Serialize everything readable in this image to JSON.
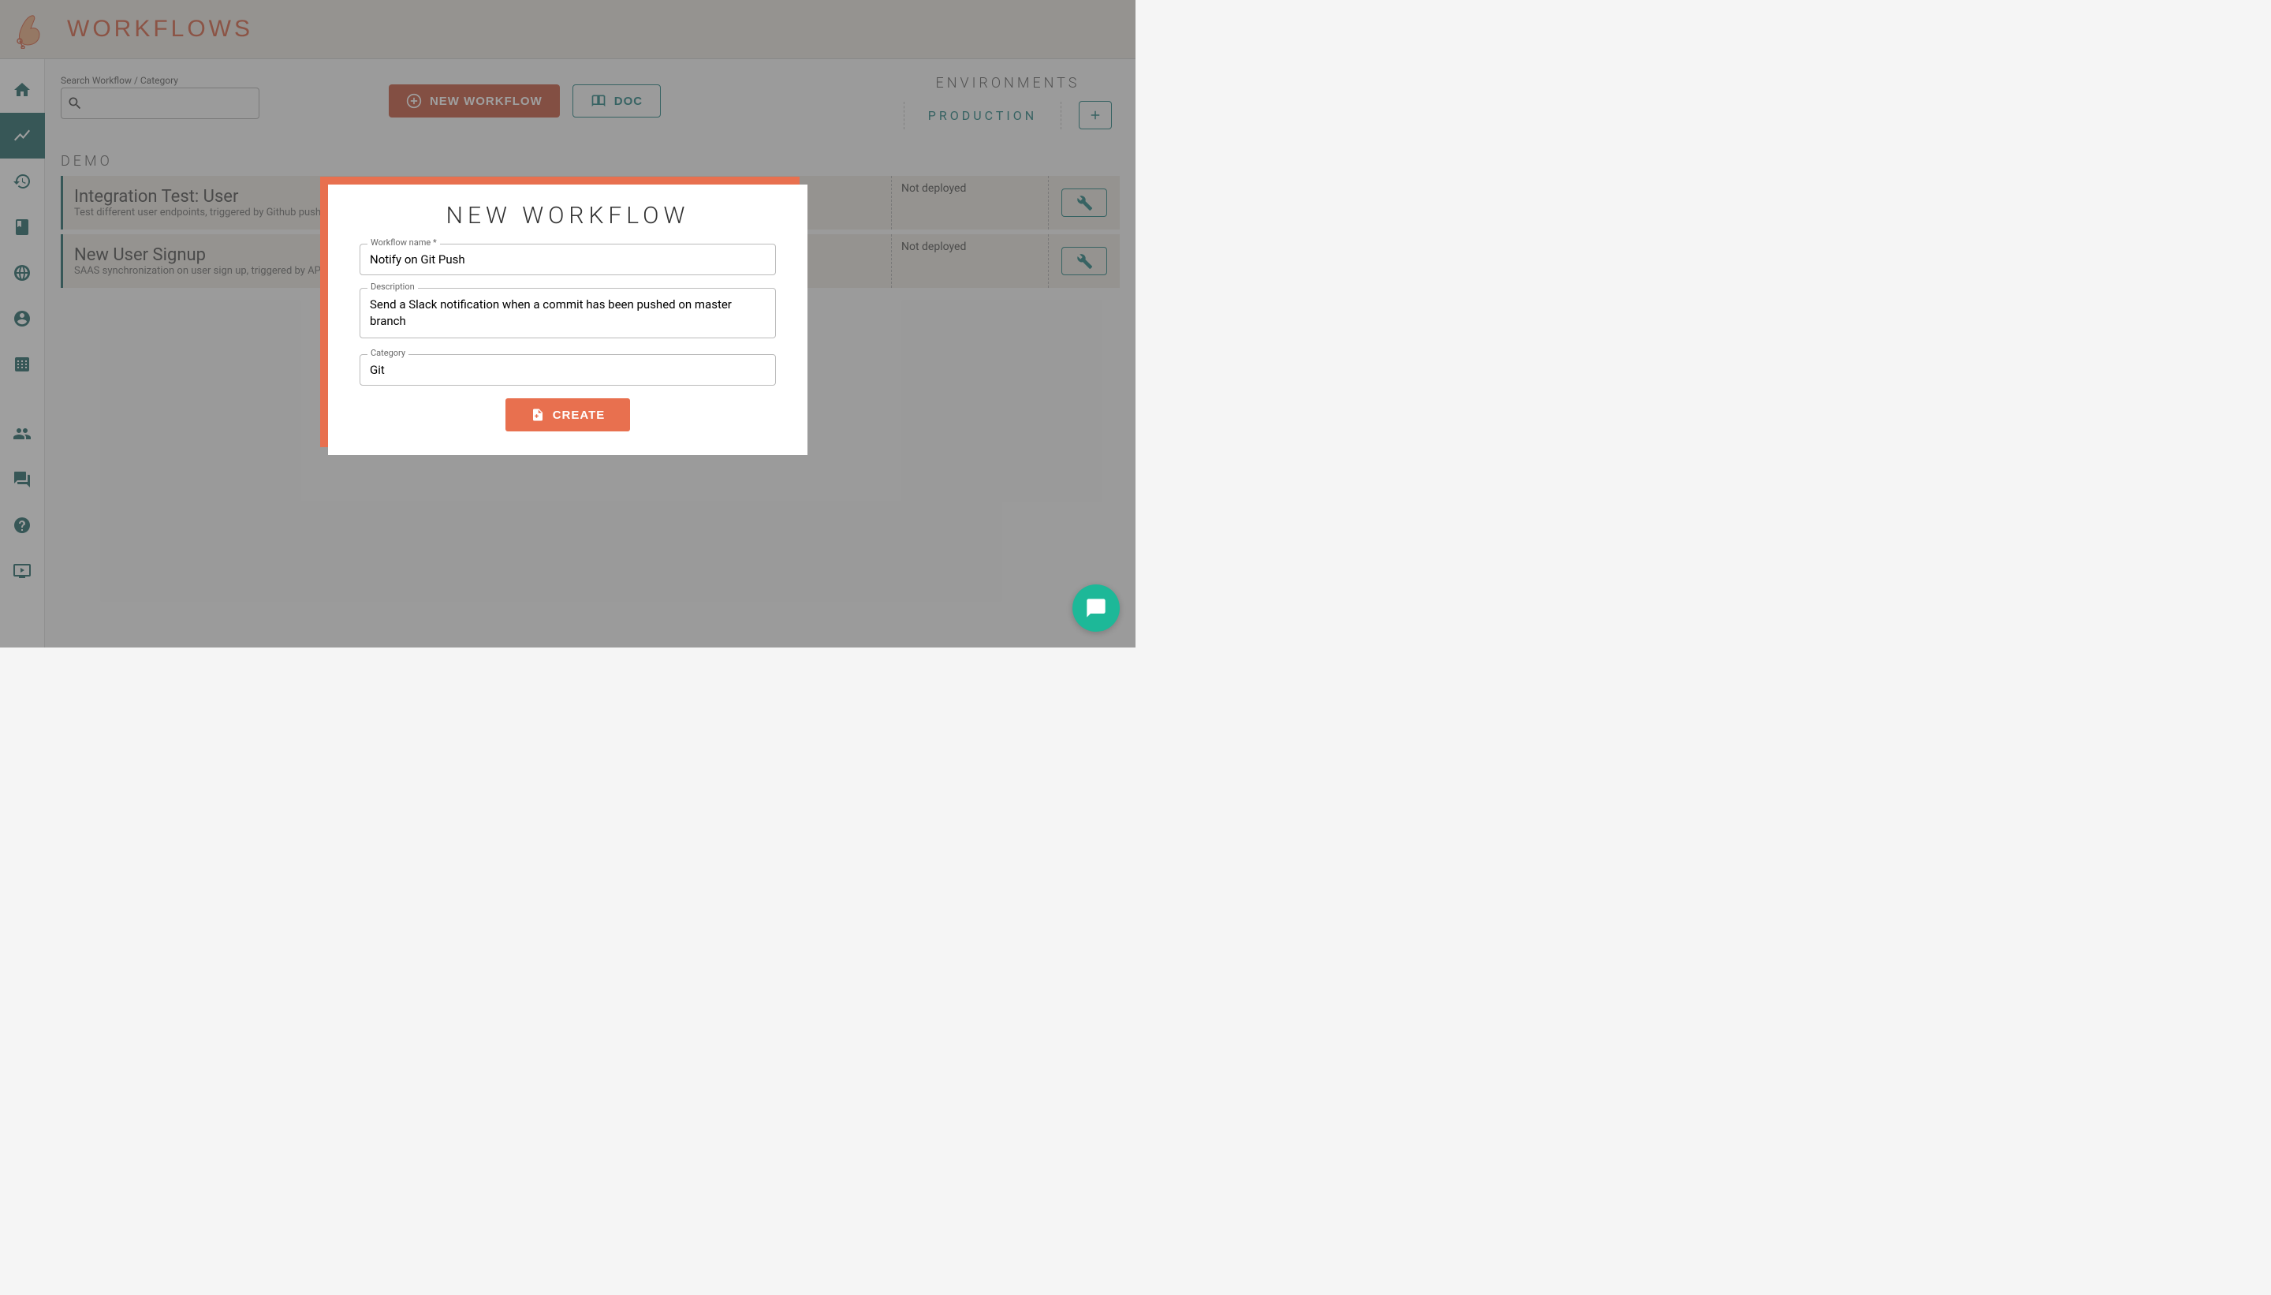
{
  "header": {
    "title": "WORKFLOWS"
  },
  "search": {
    "label": "Search Workflow / Category",
    "value": ""
  },
  "toolbar": {
    "new_workflow": "NEW WORKFLOW",
    "doc": "DOC"
  },
  "environments": {
    "title": "ENVIRONMENTS",
    "items": [
      "PRODUCTION"
    ]
  },
  "categories": [
    {
      "name": "DEMO",
      "workflows": [
        {
          "name": "Integration Test: User",
          "description": "Test different user endpoints, triggered by Github push",
          "status": "Not deployed"
        },
        {
          "name": "New User Signup",
          "description": "SAAS synchronization on user sign up, triggered by API",
          "status": "Not deployed"
        }
      ]
    }
  ],
  "modal": {
    "title": "NEW WORKFLOW",
    "fields": {
      "name_label": "Workflow name *",
      "name_value": "Notify on Git Push",
      "description_label": "Description",
      "description_value": "Send a Slack notification when a commit has been pushed on master branch",
      "category_label": "Category",
      "category_value": "Git"
    },
    "create_label": "CREATE"
  }
}
